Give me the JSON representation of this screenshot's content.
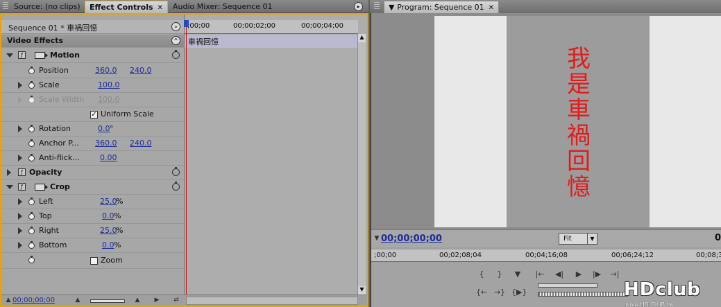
{
  "left_tabs": [
    {
      "label": "Source: (no clips)",
      "active": false
    },
    {
      "label": "Effect Controls",
      "active": true
    },
    {
      "label": "Audio Mixer: Sequence 01",
      "active": false
    }
  ],
  "program_tab": {
    "label": "Program: Sequence 01"
  },
  "effect_controls": {
    "sequence_header": "Sequence 01 * 車禍回憶",
    "section_title": "Video Effects",
    "timeline_ticks": [
      ";00;00",
      "00;00;02;00",
      "00;00;04;00"
    ],
    "clip_name": "車禍回憶",
    "motion": {
      "title": "Motion",
      "position": {
        "label": "Position",
        "x": "360.0",
        "y": "240.0"
      },
      "scale": {
        "label": "Scale",
        "value": "100.0"
      },
      "scale_width": {
        "label": "Scale Width",
        "value": "100.0"
      },
      "uniform_scale": {
        "label": "Uniform Scale",
        "checked": true
      },
      "rotation": {
        "label": "Rotation",
        "value": "0.0",
        "unit": "°"
      },
      "anchor_point": {
        "label": "Anchor P...",
        "x": "360.0",
        "y": "240.0"
      },
      "anti_flicker": {
        "label": "Anti-flick...",
        "value": "0.00"
      }
    },
    "opacity": {
      "title": "Opacity"
    },
    "crop": {
      "title": "Crop",
      "left": {
        "label": "Left",
        "value": "25.0",
        "unit": "%"
      },
      "top": {
        "label": "Top",
        "value": "0.0",
        "unit": "%"
      },
      "right": {
        "label": "Right",
        "value": "25.0",
        "unit": "%"
      },
      "bottom": {
        "label": "Bottom",
        "value": "0.0",
        "unit": "%"
      },
      "zoom": {
        "label": "Zoom",
        "checked": false
      }
    },
    "bottom_timecode": "00;00;00;00"
  },
  "program_monitor": {
    "overlay_text": [
      "我",
      "是",
      "車",
      "禍",
      "回",
      "憶"
    ],
    "timecode": "00;00;00;00",
    "fit_select": "Fit",
    "right_digit": "0",
    "ruler_ticks": [
      ";00;00",
      "00;02;08;04",
      "00;04;16;08",
      "00;06;24;12",
      "00;08;3"
    ],
    "watermark": {
      "title": "HDclub",
      "url": "www.HD.CLUB.tw"
    }
  },
  "colors": {
    "accent_border": "#e8a400",
    "timecode_blue": "#1a2d9a",
    "overlay_red": "#e31b1b",
    "playhead_red": "#d01010"
  }
}
